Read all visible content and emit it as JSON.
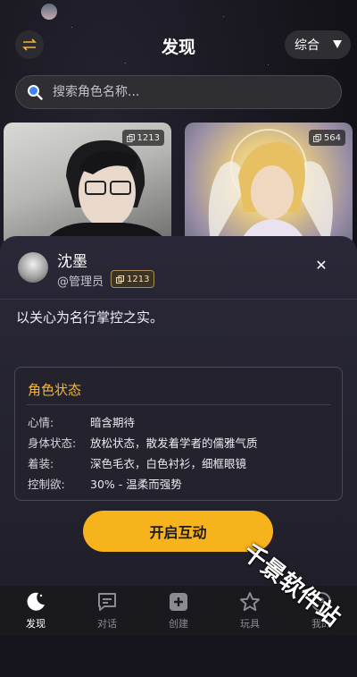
{
  "header": {
    "title": "发现",
    "sort_label": "综合"
  },
  "search": {
    "placeholder": "搜索角色名称..."
  },
  "cards": [
    {
      "count": "1213"
    },
    {
      "count": "564"
    }
  ],
  "sheet": {
    "name": "沈墨",
    "role": "@管理员",
    "count": "1213",
    "description": "以关心为名行掌控之实。",
    "status": {
      "title": "角色状态",
      "rows": [
        {
          "label": "心情:",
          "value": "暗含期待"
        },
        {
          "label": "身体状态:",
          "value": "放松状态，散发着学者的儒雅气质"
        },
        {
          "label": "着装:",
          "value": "深色毛衣，白色衬衫，细框眼镜"
        },
        {
          "label": "控制欲:",
          "value": "30% - 温柔而强势"
        }
      ]
    },
    "start_button": "开启互动"
  },
  "nav": [
    {
      "label": "发现",
      "icon": "moon-icon",
      "active": true
    },
    {
      "label": "对话",
      "icon": "chat-icon"
    },
    {
      "label": "创建",
      "icon": "plus-square-icon"
    },
    {
      "label": "玩具",
      "icon": "star-icon"
    },
    {
      "label": "我的",
      "icon": "user-icon"
    }
  ],
  "watermark": "千景软件站",
  "colors": {
    "accent": "#f7b31b",
    "status_title": "#f2b53a",
    "background": "#16141c"
  }
}
